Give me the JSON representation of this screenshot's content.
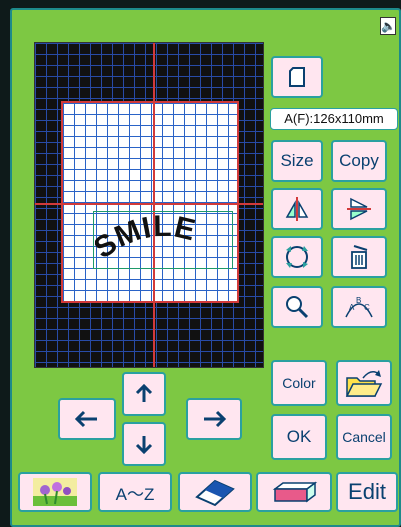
{
  "size_display": "A(F):126x110mm",
  "buttons": {
    "size": "Size",
    "copy": "Copy",
    "color": "Color",
    "ok": "OK",
    "cancel": "Cancel",
    "edit": "Edit"
  },
  "design_text": "SMILE",
  "tabs": {
    "font_tab": "A～Z"
  },
  "icons": {
    "speaker": "speaker-icon",
    "frame": "frame-icon",
    "mirror": "mirror-icon",
    "flip": "flip-icon",
    "rotate": "rotate-icon",
    "delete": "trash-icon",
    "zoom": "magnifier-icon",
    "array": "arc-text-icon",
    "open": "open-folder-icon",
    "arrow_up": "arrow-up-icon",
    "arrow_down": "arrow-down-icon",
    "arrow_left": "arrow-left-icon",
    "arrow_right": "arrow-right-icon",
    "tab_image": "embroidery-image-icon",
    "tab_eraser": "eraser-icon",
    "tab_card": "memory-card-icon"
  },
  "colors": {
    "background": "#7dc843",
    "button": "#ffe6f0",
    "border": "#2aa0a0",
    "hoop_border": "#d23a3a",
    "grid": "#2a4fb0"
  }
}
